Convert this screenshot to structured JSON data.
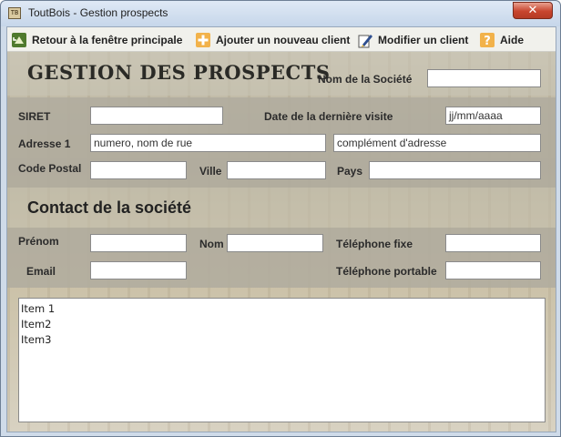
{
  "window": {
    "app_icon_text": "TB",
    "title": "ToutBois - Gestion prospects",
    "close_glyph": "✕"
  },
  "toolbar": {
    "items": [
      {
        "label": "Retour à la fenêtre principale",
        "icon": "home-return-icon"
      },
      {
        "label": "Ajouter un nouveau client",
        "icon": "plus-icon"
      },
      {
        "label": "Modifier un client",
        "icon": "edit-pencil-icon"
      },
      {
        "label": "Aide",
        "icon": "help-question-icon"
      }
    ]
  },
  "header": {
    "title": "GESTION DES PROSPECTS",
    "company_label": "Nom de la Société",
    "company_value": ""
  },
  "company": {
    "siret_label": "SIRET",
    "siret_value": "",
    "last_visit_label": "Date de la dernière visite",
    "last_visit_value": "jj/mm/aaaa",
    "address_label": "Adresse 1",
    "address_value": "numero, nom de rue",
    "address2_value": "complément d'adresse",
    "postal_label": "Code Postal",
    "postal_value": "",
    "city_label": "Ville",
    "city_value": "",
    "country_label": "Pays",
    "country_value": ""
  },
  "contact": {
    "section_title": "Contact de la société",
    "firstname_label": "Prénom",
    "firstname_value": "",
    "lastname_label": "Nom",
    "lastname_value": "",
    "phone_label": "Téléphone fixe",
    "phone_value": "",
    "email_label": "Email",
    "email_value": "",
    "mobile_label": "Téléphone portable",
    "mobile_value": ""
  },
  "list": {
    "items": [
      "Item 1",
      "Item2",
      "Item3"
    ]
  }
}
